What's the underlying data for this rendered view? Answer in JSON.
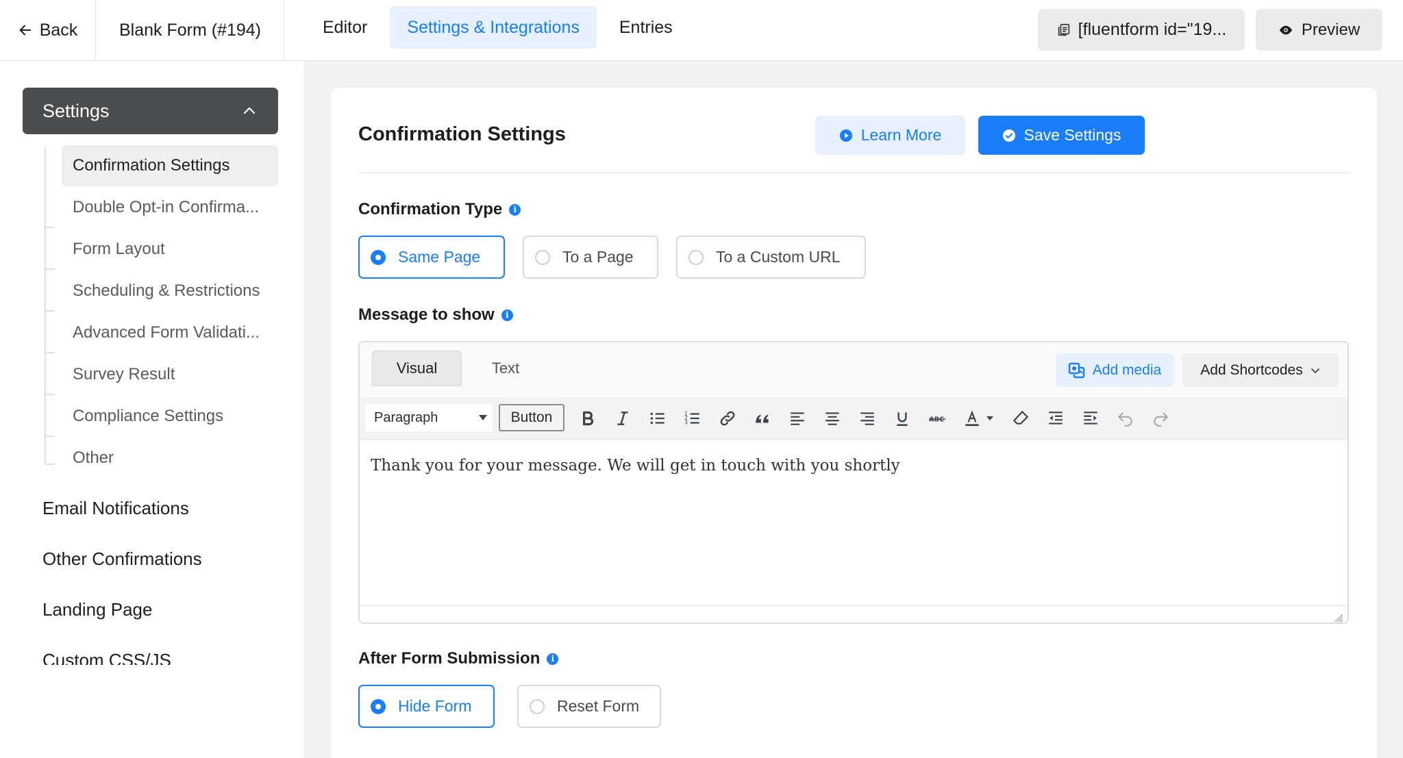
{
  "topbar": {
    "back_label": "Back",
    "form_name": "Blank Form (#194)",
    "tabs": [
      {
        "label": "Editor",
        "active": false
      },
      {
        "label": "Settings & Integrations",
        "active": true
      },
      {
        "label": "Entries",
        "active": false
      }
    ],
    "shortcode": "[fluentform id=\"19...",
    "preview_label": "Preview"
  },
  "sidebar": {
    "settings_label": "Settings",
    "sub_items": [
      {
        "label": "Confirmation Settings",
        "active": true
      },
      {
        "label": "Double Opt-in Confirma..."
      },
      {
        "label": "Form Layout"
      },
      {
        "label": "Scheduling & Restrictions"
      },
      {
        "label": "Advanced Form Validati..."
      },
      {
        "label": "Survey Result"
      },
      {
        "label": "Compliance Settings"
      },
      {
        "label": "Other"
      }
    ],
    "main_items": [
      {
        "label": "Email Notifications"
      },
      {
        "label": "Other Confirmations"
      },
      {
        "label": "Landing Page"
      },
      {
        "label": "Custom CSS/JS"
      }
    ]
  },
  "card": {
    "title": "Confirmation Settings",
    "learn_more_label": "Learn More",
    "save_label": "Save Settings",
    "confirmation_type": {
      "label": "Confirmation Type",
      "options": [
        {
          "label": "Same Page",
          "selected": true
        },
        {
          "label": "To a Page",
          "selected": false
        },
        {
          "label": "To a Custom URL",
          "selected": false
        }
      ]
    },
    "message": {
      "label": "Message to show",
      "tab_visual": "Visual",
      "tab_text": "Text",
      "add_media_label": "Add media",
      "add_shortcodes_label": "Add Shortcodes",
      "format_value": "Paragraph",
      "button_label": "Button",
      "content": "Thank you for your message. We will get in touch with you shortly"
    },
    "after_submission": {
      "label": "After Form Submission",
      "options": [
        {
          "label": "Hide Form",
          "selected": true
        },
        {
          "label": "Reset Form",
          "selected": false
        }
      ]
    }
  },
  "colors": {
    "accent": "#1a7efb",
    "accent_light": "#e6f1fd",
    "sidebar_header": "#4b4c4d"
  }
}
